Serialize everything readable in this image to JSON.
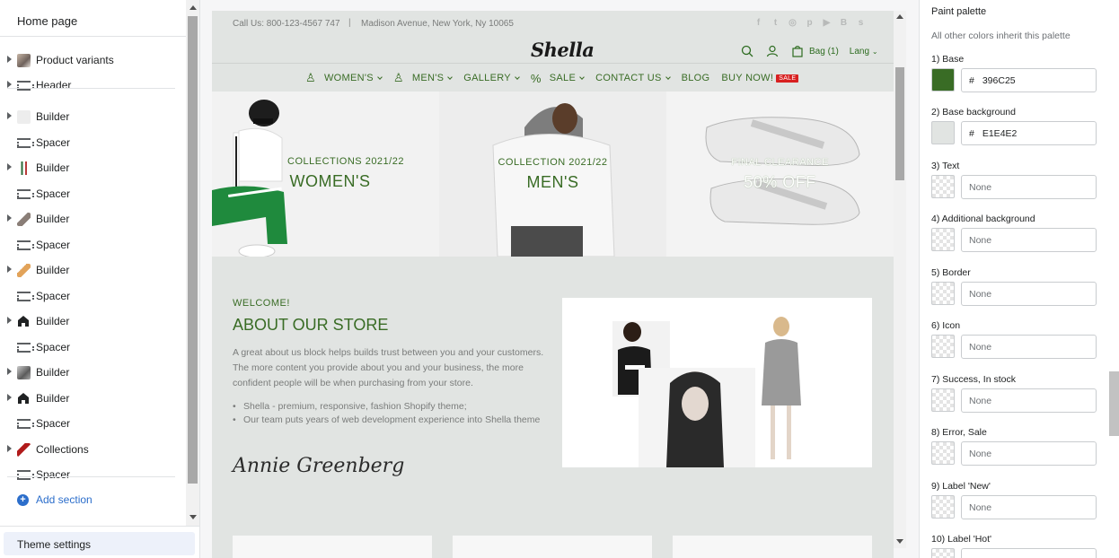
{
  "left_panel": {
    "title": "Home page",
    "tree": [
      {
        "label": "Product variants",
        "kind": "photo"
      },
      {
        "label": "Header",
        "kind": "spacer"
      },
      {
        "label": "Builder",
        "kind": "blank"
      },
      {
        "label": "Spacer",
        "kind": "spacer"
      },
      {
        "label": "Builder",
        "kind": "multi"
      },
      {
        "label": "Spacer",
        "kind": "spacer"
      },
      {
        "label": "Builder",
        "kind": "person"
      },
      {
        "label": "Spacer",
        "kind": "spacer"
      },
      {
        "label": "Builder",
        "kind": "orange"
      },
      {
        "label": "Spacer",
        "kind": "spacer"
      },
      {
        "label": "Builder",
        "kind": "home"
      },
      {
        "label": "Spacer",
        "kind": "spacer"
      },
      {
        "label": "Builder",
        "kind": "hoodie"
      },
      {
        "label": "Builder",
        "kind": "home"
      },
      {
        "label": "Spacer",
        "kind": "spacer"
      },
      {
        "label": "Collections",
        "kind": "red"
      },
      {
        "label": "Spacer",
        "kind": "spacer"
      }
    ],
    "add_section": "Add section",
    "theme_settings": "Theme settings"
  },
  "preview": {
    "topbar": {
      "contact": "Call Us: 800-123-4567 747",
      "separator": "|",
      "address": "Madison Avenue, New York, Ny 10065",
      "social_icons": [
        "facebook-icon",
        "twitter-icon",
        "instagram-icon",
        "pinterest-icon",
        "youtube-icon",
        "behance-icon",
        "skype-icon"
      ]
    },
    "logo": "Shella",
    "header": {
      "bag": "Bag (1)",
      "lang": "Lang"
    },
    "nav": [
      {
        "label": "WOMEN'S",
        "icon": "dress-icon",
        "chevron": true
      },
      {
        "label": "MEN'S",
        "icon": "shirt-icon",
        "chevron": true
      },
      {
        "label": "GALLERY",
        "chevron": true
      },
      {
        "label": "SALE",
        "icon": "percent-icon",
        "chevron": true
      },
      {
        "label": "CONTACT US",
        "chevron": true
      },
      {
        "label": "BLOG",
        "chevron": false
      },
      {
        "label": "BUY NOW!",
        "badge": "SALE",
        "chevron": false
      }
    ],
    "banners": [
      {
        "sub": "COLLECTIONS 2021/22",
        "big": "WOMEN'S"
      },
      {
        "sub": "COLLECTION 2021/22",
        "big": "MEN'S"
      },
      {
        "sub": "FINAL CLEARANCE",
        "big": "50% OFF"
      }
    ],
    "about": {
      "welcome": "WELCOME!",
      "title": "ABOUT OUR STORE",
      "text": "A great about us block helps builds trust between you and your customers. The more content you provide about you and your business, the more confident people will be when purchasing from your store.",
      "bullets": [
        "Shella - premium, responsive, fashion Shopify theme;",
        "Our team puts years of web development experience into Shella theme"
      ],
      "signature": "Annie Greenberg"
    }
  },
  "right_panel": {
    "title": "Paint palette",
    "subtitle": "All other colors inherit this palette",
    "fields": [
      {
        "label": "1) Base",
        "hash": "#",
        "value": "396C25",
        "color": "#396C25",
        "empty": false
      },
      {
        "label": "2) Base background",
        "hash": "#",
        "value": "E1E4E2",
        "color": "#E1E4E2",
        "empty": false
      },
      {
        "label": "3) Text",
        "hash": "",
        "value": "None",
        "empty": true
      },
      {
        "label": "4) Additional background",
        "hash": "",
        "value": "None",
        "empty": true
      },
      {
        "label": "5) Border",
        "hash": "",
        "value": "None",
        "empty": true
      },
      {
        "label": "6) Icon",
        "hash": "",
        "value": "None",
        "empty": true
      },
      {
        "label": "7) Success, In stock",
        "hash": "",
        "value": "None",
        "empty": true
      },
      {
        "label": "8) Error, Sale",
        "hash": "",
        "value": "None",
        "empty": true
      },
      {
        "label": "9) Label 'New'",
        "hash": "",
        "value": "None",
        "empty": true
      },
      {
        "label": "10) Label 'Hot'",
        "hash": "",
        "value": "",
        "empty": true
      }
    ]
  },
  "colors": {
    "accent_green": "#396C25",
    "link_blue": "#2C6ECB",
    "sale_red": "#D82020"
  }
}
